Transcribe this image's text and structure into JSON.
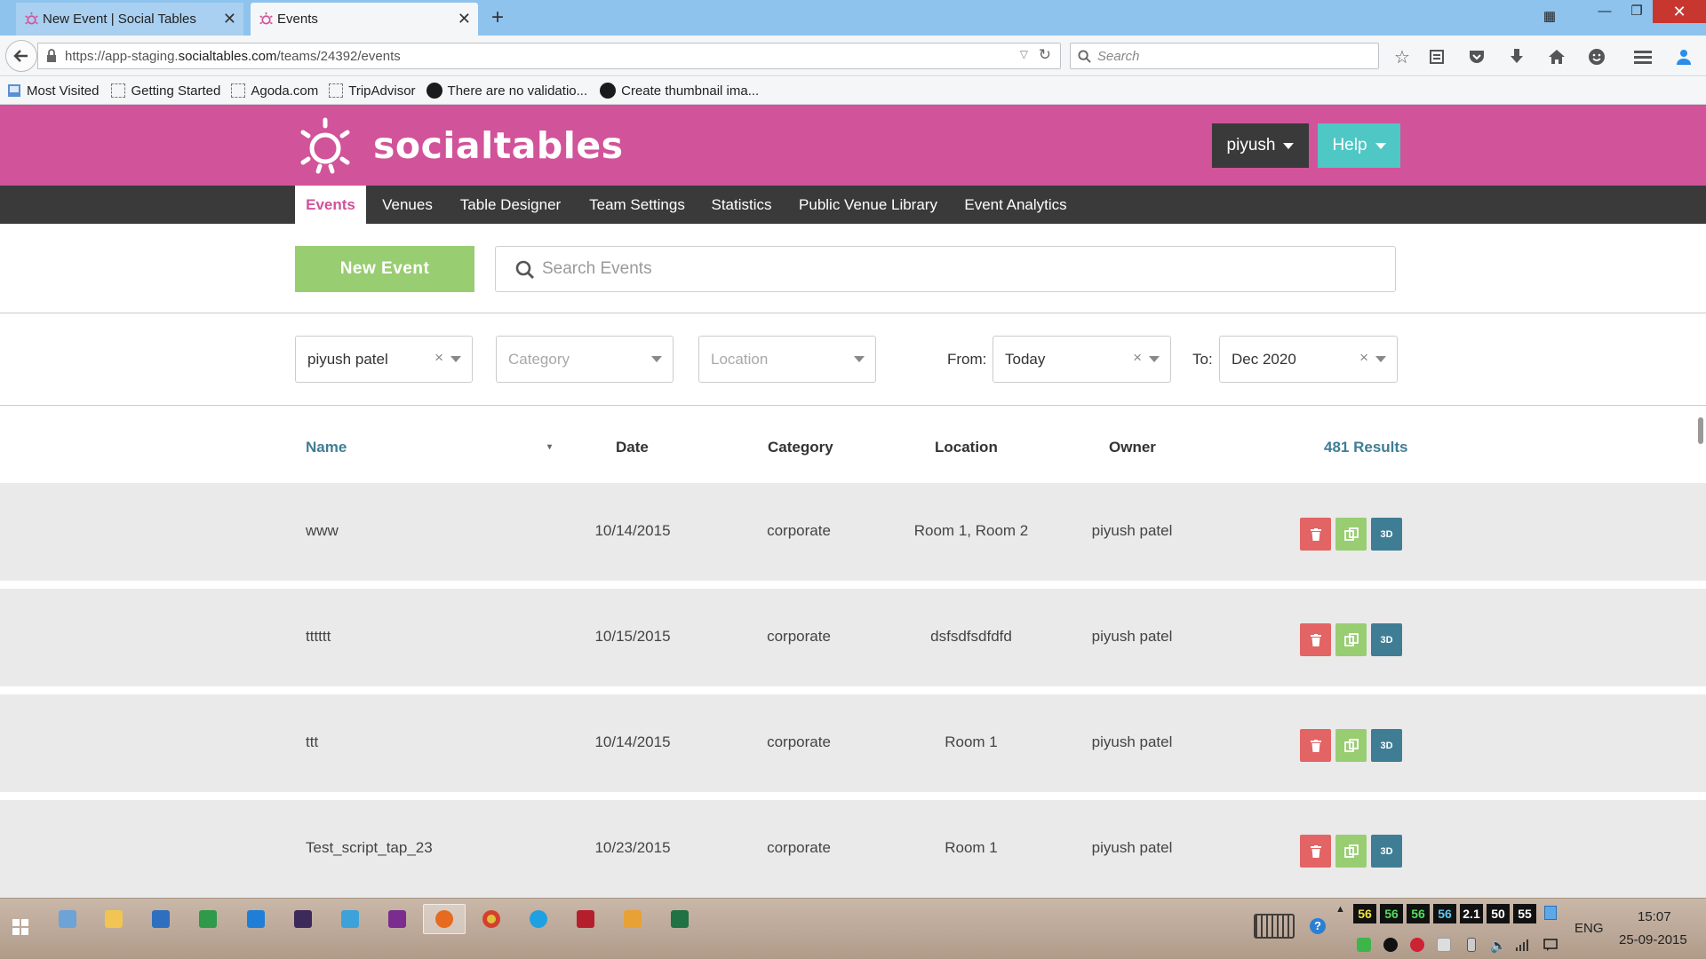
{
  "browser": {
    "tabs": [
      {
        "title": "New Event | Social Tables",
        "active": false
      },
      {
        "title": "Events",
        "active": true
      }
    ],
    "url_prefix": "https://app-staging.",
    "url_host": "socialtables.com",
    "url_path": "/teams/24392/events",
    "search_placeholder": "Search",
    "bookmarks": [
      {
        "label": "Most Visited",
        "icon": "bookmark-folder-icon"
      },
      {
        "label": "Getting Started",
        "icon": "blank-page-icon"
      },
      {
        "label": "Agoda.com",
        "icon": "blank-page-icon"
      },
      {
        "label": "TripAdvisor",
        "icon": "blank-page-icon"
      },
      {
        "label": "There are no validatio...",
        "icon": "github-icon"
      },
      {
        "label": "Create thumbnail ima...",
        "icon": "github-icon"
      }
    ]
  },
  "header": {
    "brand": "socialtables",
    "user_label": "piyush",
    "help_label": "Help",
    "colors": {
      "brand": "#d1539a",
      "dark": "#3a3a3a",
      "help": "#4fc7c4",
      "green": "#98cd72",
      "blue": "#3f7d95",
      "red": "#e36464"
    }
  },
  "nav": {
    "items": [
      "Events",
      "Venues",
      "Table Designer",
      "Team Settings",
      "Statistics",
      "Public Venue Library",
      "Event Analytics"
    ],
    "active": "Events"
  },
  "toolbar": {
    "new_event_label": "New Event",
    "search_placeholder": "Search Events"
  },
  "filters": {
    "owner_value": "piyush patel",
    "category_placeholder": "Category",
    "location_placeholder": "Location",
    "from_label": "From:",
    "from_value": "Today",
    "to_label": "To:",
    "to_value": "Dec 2020"
  },
  "table": {
    "columns": [
      "Name",
      "Date",
      "Category",
      "Location",
      "Owner"
    ],
    "results_label": "481 Results",
    "rows": [
      {
        "name": "www",
        "date": "10/14/2015",
        "category": "corporate",
        "location": "Room 1, Room 2",
        "owner": "piyush patel"
      },
      {
        "name": "tttttt",
        "date": "10/15/2015",
        "category": "corporate",
        "location": "dsfsdfsdfdfd",
        "owner": "piyush patel"
      },
      {
        "name": "ttt",
        "date": "10/14/2015",
        "category": "corporate",
        "location": "Room 1",
        "owner": "piyush patel"
      },
      {
        "name": "Test_script_tap_23",
        "date": "10/23/2015",
        "category": "corporate",
        "location": "Room 1",
        "owner": "piyush patel"
      }
    ],
    "action_3d_label": "3D"
  },
  "taskbar": {
    "tray_numbers": [
      "56",
      "56",
      "56",
      "56",
      "2.1",
      "50",
      "55"
    ],
    "language": "ENG",
    "time": "15:07",
    "date": "25-09-2015"
  }
}
